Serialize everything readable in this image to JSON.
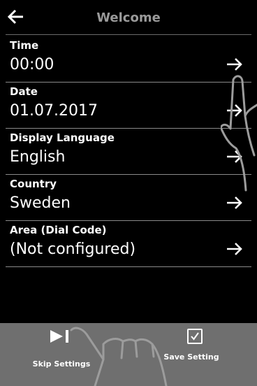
{
  "header": {
    "title": "Welcome",
    "back_icon": "arrow-left-icon"
  },
  "settings": [
    {
      "label": "Time",
      "value": "00:00"
    },
    {
      "label": "Date",
      "value": "01.07.2017"
    },
    {
      "label": "Display Language",
      "value": "English"
    },
    {
      "label": "Country",
      "value": "Sweden"
    },
    {
      "label": "Area (Dial Code)",
      "value": "(Not configured)"
    }
  ],
  "footer": {
    "skip_label": "Skip Settings",
    "save_label": "Save Setting",
    "skip_icon": "skip-forward-icon",
    "save_icon": "checkbox-checked-icon"
  },
  "colors": {
    "background": "#000000",
    "title": "#9a9a9a",
    "footer_bg": "#6f6f6f",
    "divider": "#8a8a8a"
  }
}
